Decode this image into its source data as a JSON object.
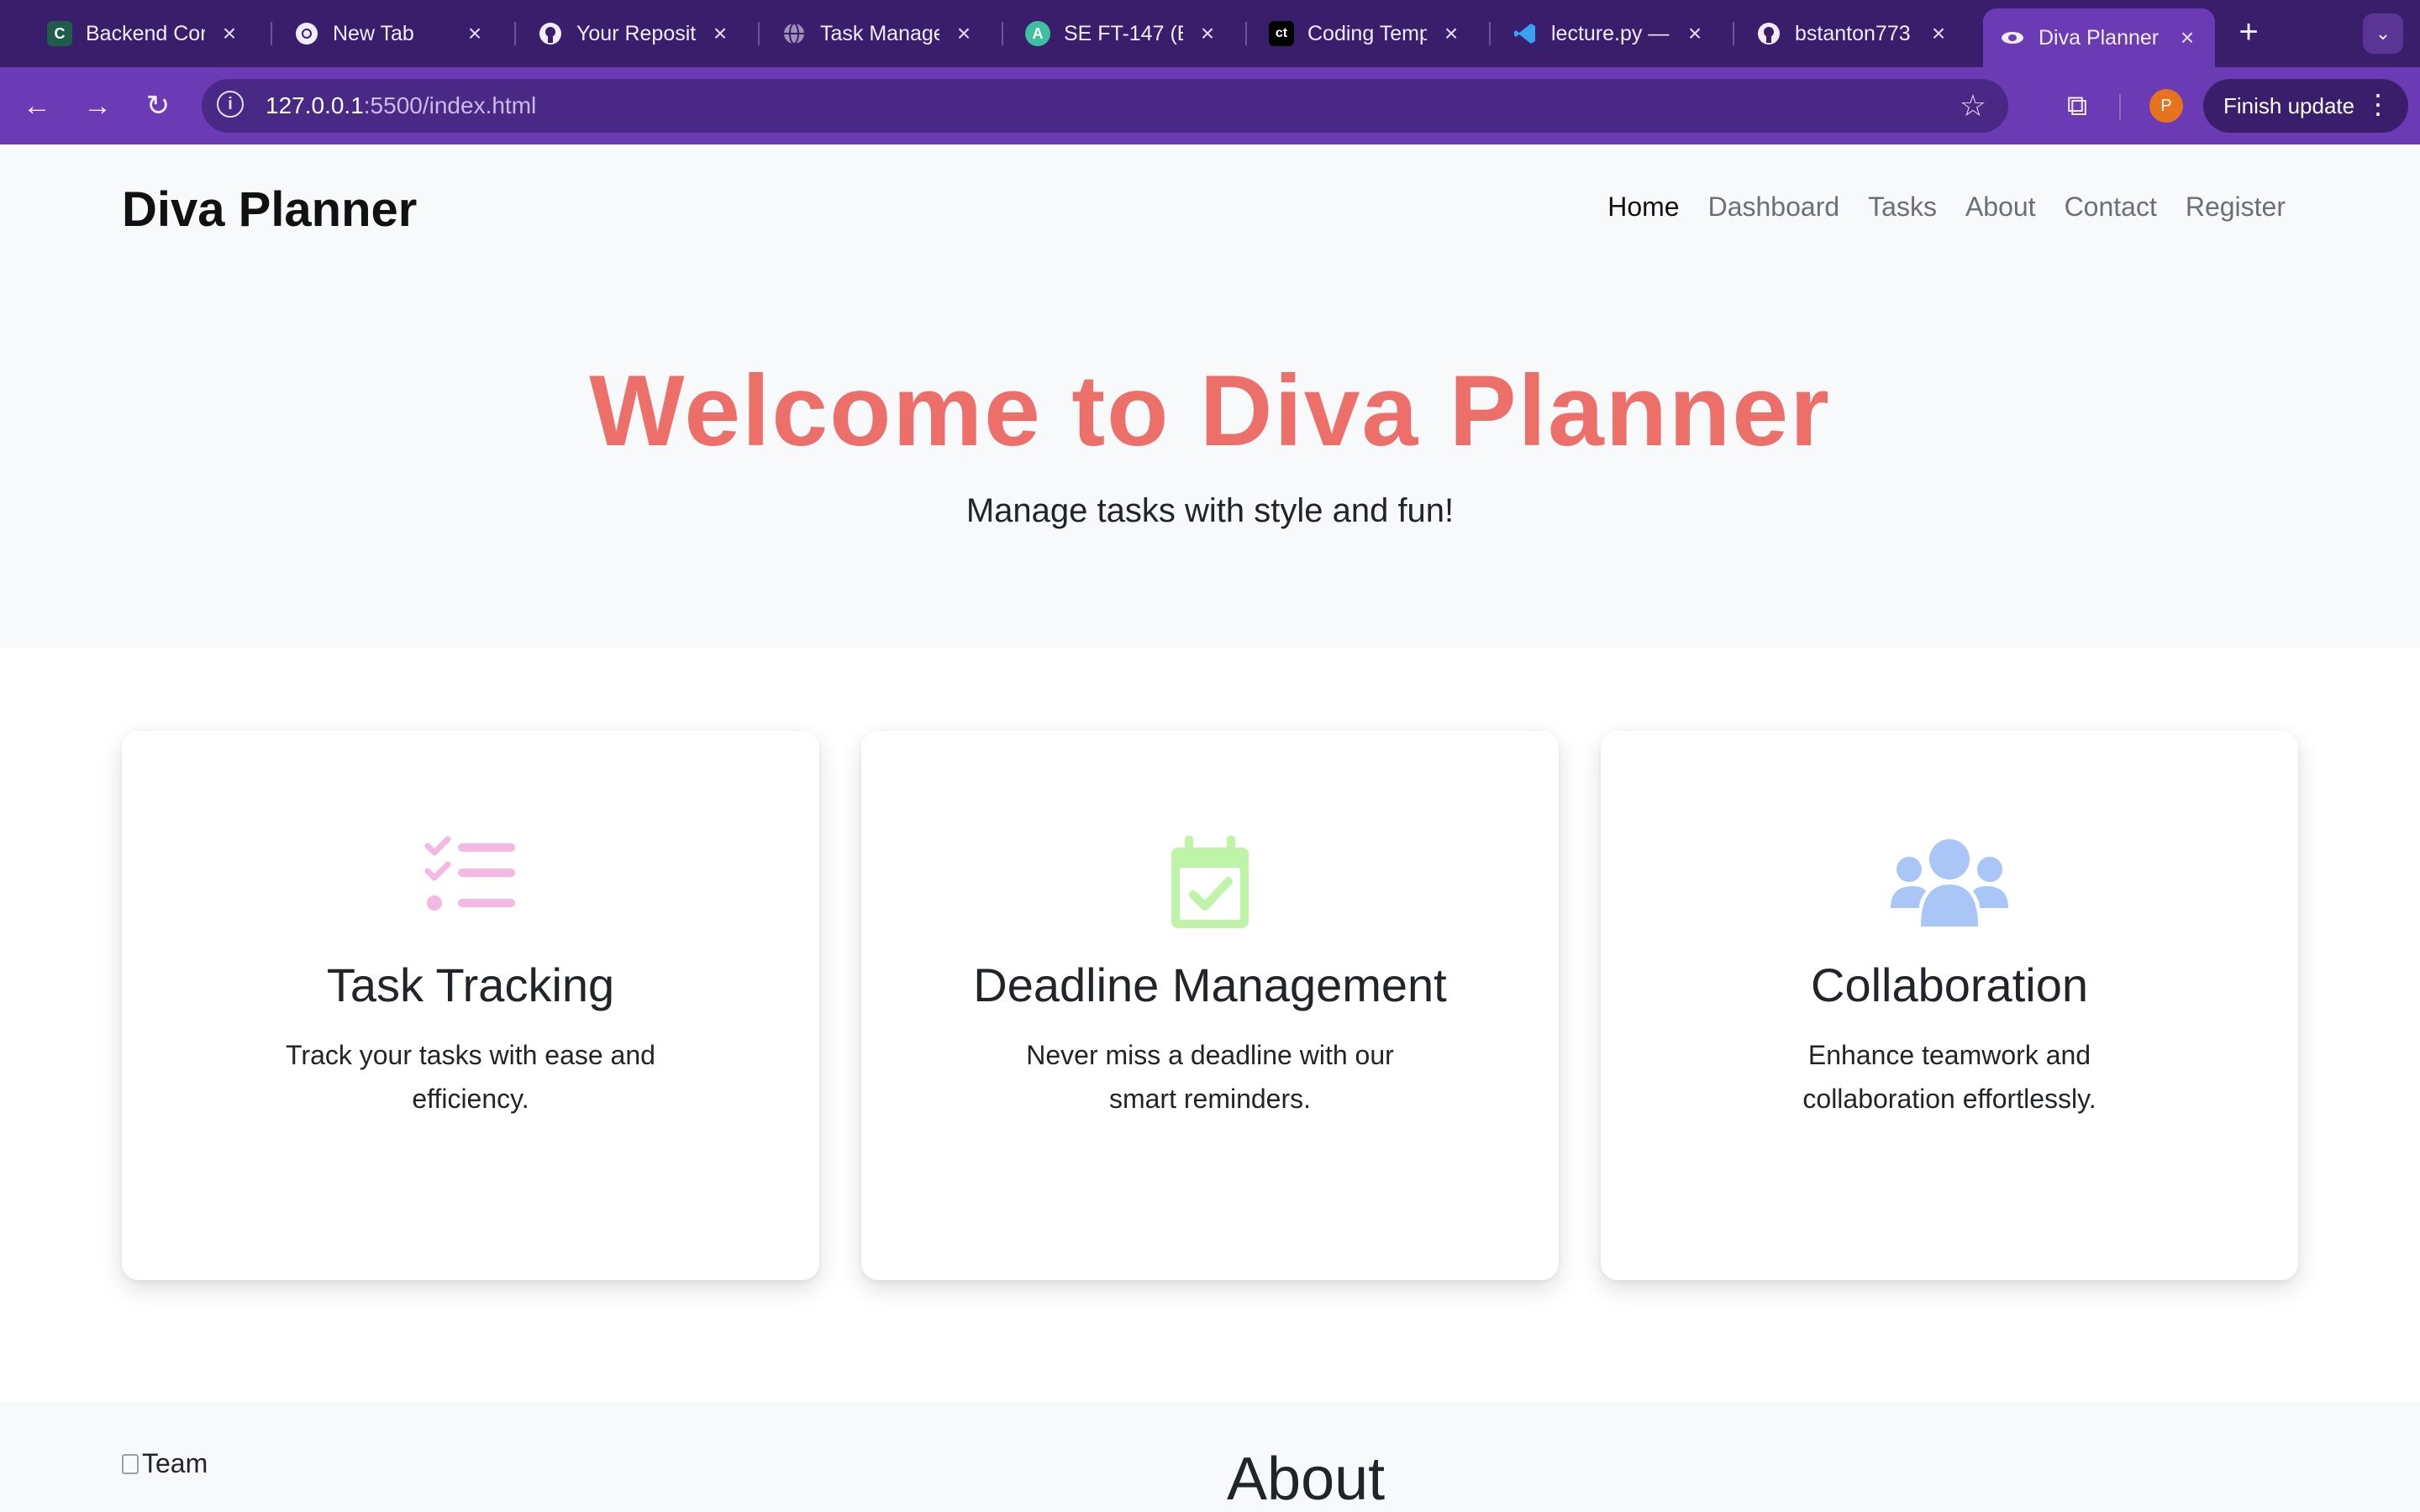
{
  "browser": {
    "tabs": [
      {
        "title": "Backend Cor",
        "icon": "coding-temple-icon"
      },
      {
        "title": "New Tab",
        "icon": "chrome-icon"
      },
      {
        "title": "Your Reposit",
        "icon": "github-icon"
      },
      {
        "title": "Task Manage",
        "icon": "globe-icon"
      },
      {
        "title": "SE FT-147 (B",
        "icon": "app-icon"
      },
      {
        "title": "Coding Temp",
        "icon": "ct-icon"
      },
      {
        "title": "lecture.py —",
        "icon": "vscode-icon"
      },
      {
        "title": "bstanton773",
        "icon": "github-icon"
      },
      {
        "title": "Diva Planner",
        "icon": "diva-icon",
        "active": true
      }
    ],
    "url_host": "127.0.0.1",
    "url_path": ":5500/index.html",
    "profile_initial": "P",
    "update_label": "Finish update"
  },
  "site": {
    "brand": "Diva Planner",
    "nav": [
      {
        "label": "Home",
        "active": true
      },
      {
        "label": "Dashboard"
      },
      {
        "label": "Tasks"
      },
      {
        "label": "About"
      },
      {
        "label": "Contact"
      },
      {
        "label": "Register"
      }
    ],
    "hero": {
      "title": "Welcome to Diva Planner",
      "subtitle": "Manage tasks with style and fun!"
    },
    "features": [
      {
        "title": "Task Tracking",
        "text": "Track your tasks with ease and efficiency.",
        "icon": "task-list-icon",
        "color": "#f3b8e4"
      },
      {
        "title": "Deadline Management",
        "text": "Never miss a deadline with our smart reminders.",
        "icon": "calendar-check-icon",
        "color": "#bff4a8"
      },
      {
        "title": "Collaboration",
        "text": "Enhance teamwork and collaboration effortlessly.",
        "icon": "users-icon",
        "color": "#a9c6f7"
      }
    ],
    "about": {
      "image_alt": "Team",
      "heading": "About"
    }
  },
  "colors": {
    "chrome_dark": "#3b1e6b",
    "chrome": "#6a3bb4",
    "hero_title": "#ec6f69"
  }
}
